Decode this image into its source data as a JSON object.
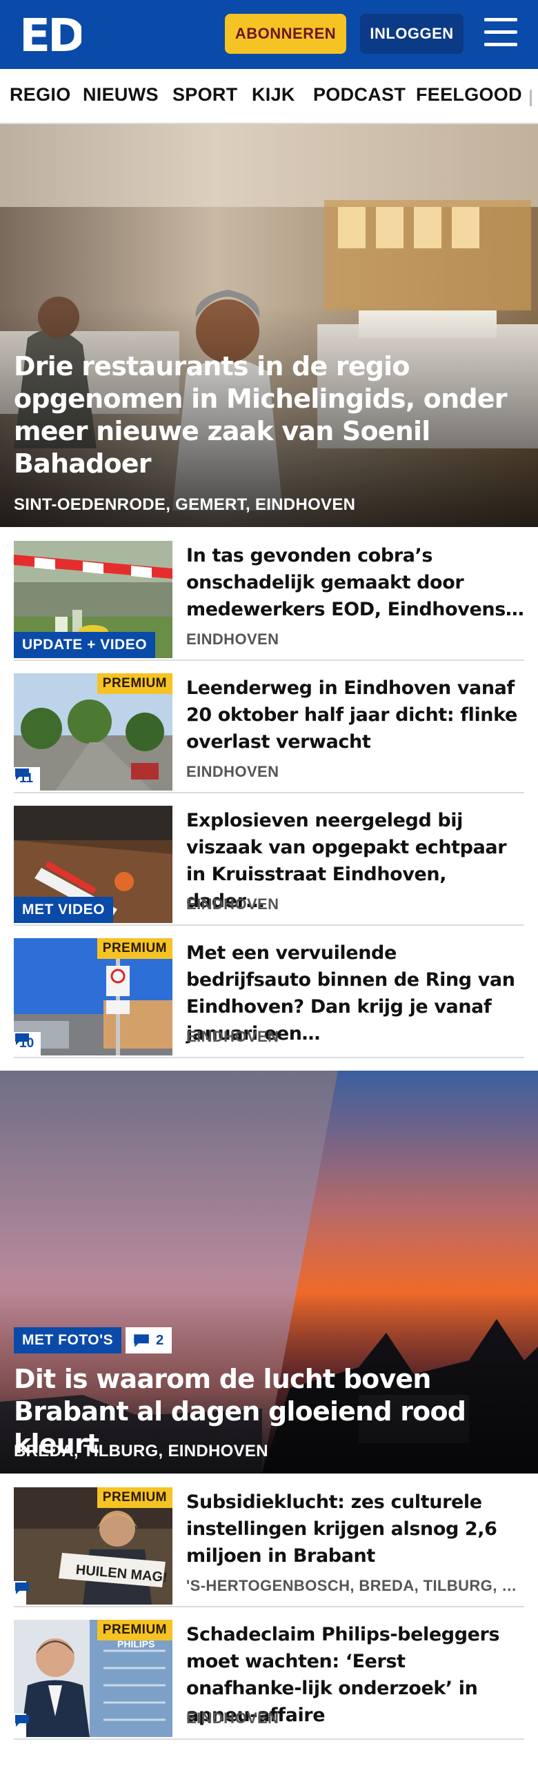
{
  "header": {
    "logo_text": "ED",
    "subscribe_label": "ABONNEREN",
    "login_label": "INLOGGEN",
    "menu_icon": "hamburger-menu-icon",
    "brand_color": "#0a4aa8",
    "accent_color": "#f6c324"
  },
  "nav": {
    "items": [
      {
        "label": "REGIO"
      },
      {
        "label": "NIEUWS"
      },
      {
        "label": "SPORT"
      },
      {
        "label": "KIJK"
      },
      {
        "label": "PODCAST"
      },
      {
        "label": "FEELGOOD"
      }
    ]
  },
  "hero": {
    "title": "Drie restaurants in de regio opgenomen in Michelingids, onder meer nieuwe zaak van Soenil Bahadoer",
    "location": "SINT-OEDENRODE, GEMERT, EINDHOVEN"
  },
  "articles": [
    {
      "title": "In tas gevonden cobra’s onschadelijk gemaakt door medewerkers EOD, Eindhovens…",
      "location": "EINDHOVEN",
      "label": "UPDATE + VIDEO",
      "premium": "",
      "comments": ""
    },
    {
      "title": "Leenderweg in Eindhoven vanaf 20 oktober half jaar dicht: flinke overlast verwacht",
      "location": "EINDHOVEN",
      "label": "",
      "premium": "PREMIUM",
      "comments": "11"
    },
    {
      "title": "Explosieven neergelegd bij viszaak van opgepakt echtpaar in Kruisstraat Eindhoven, dader…",
      "location": "EINDHOVEN",
      "label": "MET VIDEO",
      "premium": "",
      "comments": ""
    },
    {
      "title": "Met een vervuilende bedrijfsauto binnen de Ring van Eindhoven? Dan krijg je vanaf januari een…",
      "location": "EINDHOVEN",
      "label": "",
      "premium": "PREMIUM",
      "comments": "10"
    }
  ],
  "hero2": {
    "tag": "MET FOTO'S",
    "comments": "2",
    "title": "Dit is waarom de lucht boven Brabant al dagen gloeiend rood kleurt",
    "location": "BREDA, TILBURG, EINDHOVEN"
  },
  "articles2": [
    {
      "title": "Subsidieklucht: zes culturele instellingen krijgen alsnog 2,6 miljoen in Brabant",
      "location": "'S-HERTOGENBOSCH, BREDA, TILBURG, EINDHOVEN",
      "premium": "PREMIUM",
      "sign_text": "HUILEN MAG!"
    },
    {
      "title": "Schadeclaim Philips-beleggers moet wachten: ‘Eerst onafhanke-lijk onderzoek’ in apneu-affaire",
      "location": "EINDHOVEN",
      "premium": "PREMIUM",
      "sign_text": "PHILIPS"
    }
  ]
}
